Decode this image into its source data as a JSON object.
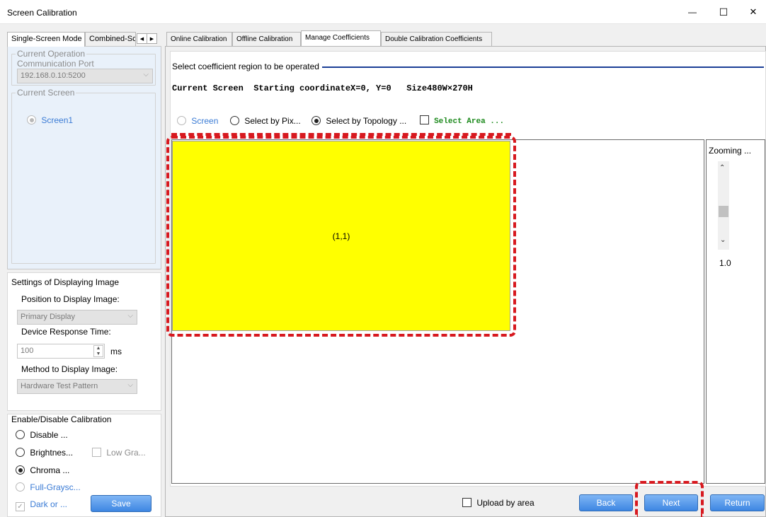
{
  "window": {
    "title": "Screen Calibration",
    "minimize": "—",
    "maximize": "☐",
    "close": "✕"
  },
  "left_tabs": [
    "Single-Screen Mode",
    "Combined-Sc"
  ],
  "current_operation": {
    "label": "Current Operation",
    "port_label": "Communication Port",
    "port_value": "192.168.0.10:5200"
  },
  "current_screen": {
    "label": "Current Screen",
    "screen_option": "Screen1"
  },
  "display_settings": {
    "label": "Settings of Displaying Image",
    "position_label": "Position to Display Image:",
    "position_value": "Primary Display",
    "response_label": "Device Response Time:",
    "response_value": "100",
    "response_unit": "ms",
    "method_label": "Method to Display Image:",
    "method_value": "Hardware Test Pattern"
  },
  "calibration": {
    "label": "Enable/Disable Calibration",
    "disable": "Disable ...",
    "brightness": "Brightnes...",
    "low_gray": "Low Gra...",
    "chroma": "Chroma ...",
    "full_grayscale": "Full-Graysc...",
    "dark_or": "Dark or ...",
    "save": "Save"
  },
  "right_tabs": [
    "Online Calibration",
    "Offline Calibration",
    "Manage Coefficients",
    "Double Calibration Coefficients"
  ],
  "region": {
    "header": "Select coefficient region to be operated",
    "current_screen_info": "Current Screen  Starting coordinateX=0, Y=0   Size480W×270H",
    "opt_screen": "Screen",
    "opt_pixel": "Select by Pix...",
    "opt_topology": "Select by Topology ...",
    "opt_area": "Select Area ..."
  },
  "canvas": {
    "cell_label": "(1,1)",
    "zoom_label": "Zooming ...",
    "zoom_value": "1.0",
    "highlight_color": "#ffff00",
    "dash_color": "#d7191f"
  },
  "footer": {
    "upload_by_area": "Upload by area",
    "back": "Back",
    "next": "Next",
    "return": "Return"
  }
}
